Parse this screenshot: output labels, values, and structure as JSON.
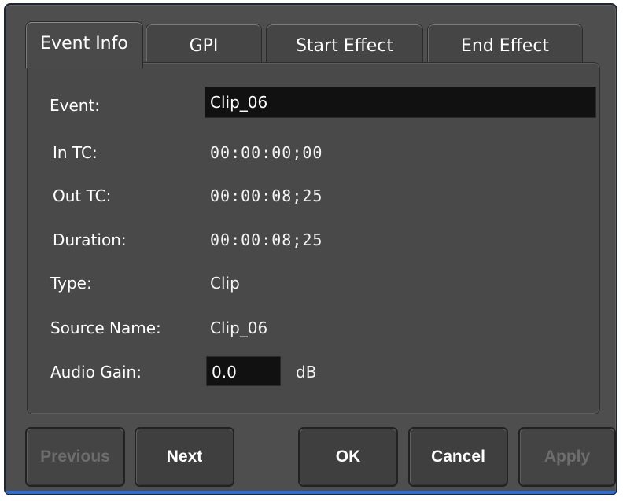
{
  "tabs": [
    {
      "label": "Event Info",
      "active": true
    },
    {
      "label": "GPI",
      "active": false
    },
    {
      "label": "Start Effect",
      "active": false
    },
    {
      "label": "End Effect",
      "active": false
    }
  ],
  "fields": {
    "event": {
      "label": "Event:",
      "value": "Clip_06"
    },
    "in_tc": {
      "label": "In TC:",
      "value": "00:00:00;00"
    },
    "out_tc": {
      "label": "Out TC:",
      "value": "00:00:08;25"
    },
    "duration": {
      "label": "Duration:",
      "value": "00:00:08;25"
    },
    "type": {
      "label": "Type:",
      "value": "Clip"
    },
    "source_name": {
      "label": "Source Name:",
      "value": "Clip_06"
    },
    "audio_gain": {
      "label": "Audio Gain:",
      "value": "0.0",
      "unit": "dB"
    }
  },
  "buttons": {
    "previous": {
      "label": "Previous",
      "enabled": false
    },
    "next": {
      "label": "Next",
      "enabled": true
    },
    "ok": {
      "label": "OK",
      "enabled": true
    },
    "cancel": {
      "label": "Cancel",
      "enabled": true
    },
    "apply": {
      "label": "Apply",
      "enabled": false
    }
  },
  "colors": {
    "background": "#4e4e4e",
    "panel": "#494949",
    "field": "#111111",
    "accent_edge": "#2a6fd8",
    "disabled_text": "#6d6d6d"
  }
}
